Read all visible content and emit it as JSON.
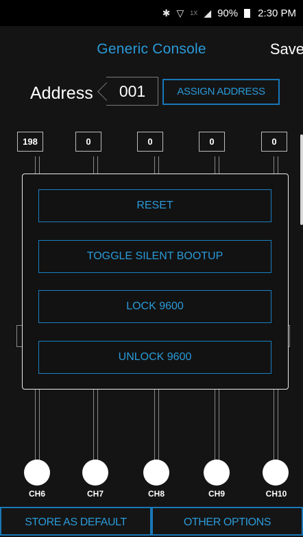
{
  "status_bar": {
    "bluetooth_icon": "bluetooth-icon",
    "wifi_icon": "wifi-icon",
    "network_type": "1X",
    "signal_icon": "signal-icon",
    "battery": "90%",
    "time": "2:30 PM"
  },
  "header": {
    "title": "Generic Console",
    "save_label": "Save"
  },
  "address": {
    "label": "Address",
    "value": "001",
    "assign_label": "ASSIGN ADDRESS"
  },
  "channels": [
    {
      "value": "198",
      "label": "CH6"
    },
    {
      "value": "0",
      "label": "CH7"
    },
    {
      "value": "0",
      "label": "CH8"
    },
    {
      "value": "0",
      "label": "CH9"
    },
    {
      "value": "0",
      "label": "CH10"
    }
  ],
  "dialog": {
    "buttons": [
      {
        "label": "RESET"
      },
      {
        "label": "TOGGLE SILENT BOOTUP"
      },
      {
        "label": "LOCK 9600"
      },
      {
        "label": "UNLOCK 9600"
      }
    ]
  },
  "bottom_bar": {
    "store_default_label": "STORE AS DEFAULT",
    "other_options_label": "OTHER OPTIONS"
  },
  "colors": {
    "accent": "#2a9ad8",
    "accent_border": "#1a80c4",
    "background": "#141414"
  }
}
